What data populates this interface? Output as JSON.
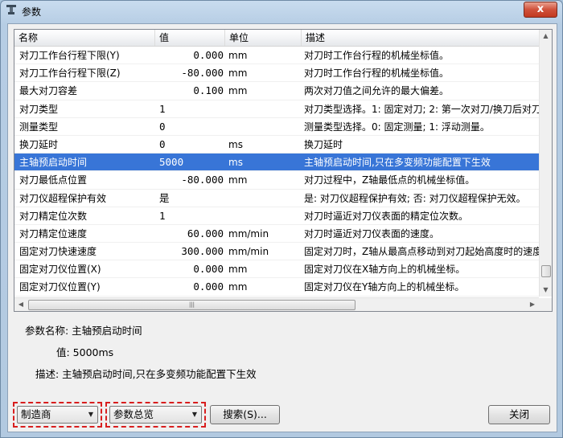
{
  "window": {
    "title": "参数",
    "close_glyph": "x"
  },
  "grid": {
    "columns": [
      "名称",
      "值",
      "单位",
      "描述"
    ],
    "rows": [
      {
        "name": "对刀工作台行程下限(Y)",
        "value": "0.000",
        "unit": "mm",
        "desc": "对刀时工作台行程的机械坐标值。",
        "align": "num"
      },
      {
        "name": "对刀工作台行程下限(Z)",
        "value": "-80.000",
        "unit": "mm",
        "desc": "对刀时工作台行程的机械坐标值。",
        "align": "num"
      },
      {
        "name": "最大对刀容差",
        "value": "0.100",
        "unit": "mm",
        "desc": "两次对刀值之间允许的最大偏差。",
        "align": "num"
      },
      {
        "name": "对刀类型",
        "value": "1",
        "unit": "",
        "desc": "对刀类型选择。1: 固定对刀; 2: 第一次对刀/换刀后对刀。",
        "align": "txt"
      },
      {
        "name": "测量类型",
        "value": "0",
        "unit": "",
        "desc": "测量类型选择。0: 固定测量; 1: 浮动测量。",
        "align": "txt"
      },
      {
        "name": "换刀延时",
        "value": "0",
        "unit": "ms",
        "desc": "换刀延时",
        "align": "txt"
      },
      {
        "name": "主轴预启动时间",
        "value": "5000",
        "unit": "ms",
        "desc": "主轴预启动时间,只在多变频功能配置下生效",
        "align": "txt",
        "selected": true
      },
      {
        "name": "对刀最低点位置",
        "value": "-80.000",
        "unit": "mm",
        "desc": "对刀过程中，Z轴最低点的机械坐标值。",
        "align": "num"
      },
      {
        "name": "对刀仪超程保护有效",
        "value": "是",
        "unit": "",
        "desc": "是: 对刀仪超程保护有效; 否: 对刀仪超程保护无效。",
        "align": "txt"
      },
      {
        "name": "对刀精定位次数",
        "value": "1",
        "unit": "",
        "desc": "对刀时逼近对刀仪表面的精定位次数。",
        "align": "txt"
      },
      {
        "name": "对刀精定位速度",
        "value": "60.000",
        "unit": "mm/min",
        "desc": "对刀时逼近对刀仪表面的速度。",
        "align": "num"
      },
      {
        "name": "固定对刀快速速度",
        "value": "300.000",
        "unit": "mm/min",
        "desc": "固定对刀时，Z轴从最高点移动到对刀起始高度时的速度。",
        "align": "num"
      },
      {
        "name": "固定对刀仪位置(X)",
        "value": "0.000",
        "unit": "mm",
        "desc": "固定对刀仪在X轴方向上的机械坐标。",
        "align": "num"
      },
      {
        "name": "固定对刀仪位置(Y)",
        "value": "0.000",
        "unit": "mm",
        "desc": "固定对刀仪在Y轴方向上的机械坐标。",
        "align": "num"
      }
    ],
    "hscroll_grip": "|||"
  },
  "detail": {
    "name_label": "参数名称: 主轴预启动时间",
    "value_label": "值: 5000ms",
    "desc_label": "描述: 主轴预启动时间,只在多变频功能配置下生效"
  },
  "footer": {
    "level_combo": "制造商",
    "group_combo": "参数总览",
    "search_button": "搜索(S)...",
    "close_button": "关闭"
  },
  "colors": {
    "selection": "#3875d7",
    "highlight_border": "#d81e1e"
  }
}
